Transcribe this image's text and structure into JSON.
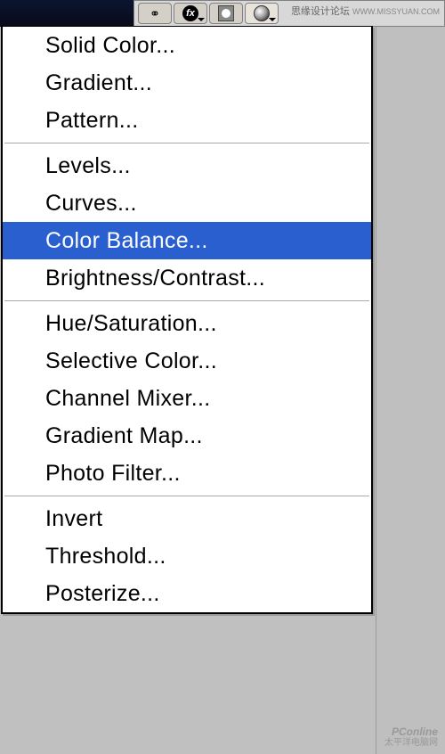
{
  "watermark_top_cn": "思缘设计论坛",
  "watermark_top_url": "WWW.MISSYUAN.COM",
  "watermark_bottom_brand": "PConline",
  "watermark_bottom_cn": "太平洋电脑网",
  "toolbar": {
    "link_icon": "link-icon",
    "fx_label": "fx",
    "mask_icon": "mask-icon",
    "adjust_icon": "adjustment-layer-icon"
  },
  "menu": {
    "groups": [
      [
        {
          "key": "solid",
          "label": "Solid Color..."
        },
        {
          "key": "gradient",
          "label": "Gradient..."
        },
        {
          "key": "pattern",
          "label": "Pattern..."
        }
      ],
      [
        {
          "key": "levels",
          "label": "Levels..."
        },
        {
          "key": "curves",
          "label": "Curves..."
        },
        {
          "key": "colorbal",
          "label": "Color Balance...",
          "highlighted": true
        },
        {
          "key": "brightcontrast",
          "label": "Brightness/Contrast..."
        }
      ],
      [
        {
          "key": "huesat",
          "label": "Hue/Saturation..."
        },
        {
          "key": "selcolor",
          "label": "Selective Color..."
        },
        {
          "key": "chanmix",
          "label": "Channel Mixer..."
        },
        {
          "key": "gradmap",
          "label": "Gradient Map..."
        },
        {
          "key": "photof",
          "label": "Photo Filter..."
        }
      ],
      [
        {
          "key": "invert",
          "label": "Invert"
        },
        {
          "key": "thresh",
          "label": "Threshold..."
        },
        {
          "key": "poster",
          "label": "Posterize..."
        }
      ]
    ]
  }
}
